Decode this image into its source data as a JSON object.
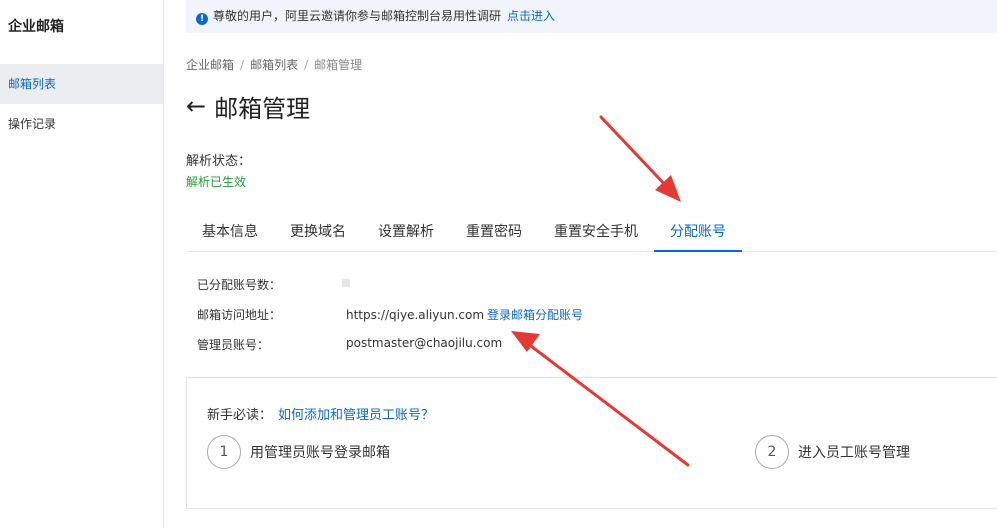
{
  "sidebar": {
    "brand": "企业邮箱",
    "items": [
      {
        "label": "邮箱列表",
        "active": true
      },
      {
        "label": "操作记录",
        "active": false
      }
    ]
  },
  "notice": {
    "icon": "info-icon",
    "text": "尊敬的用户，阿里云邀请你参与邮箱控制台易用性调研",
    "link": "点击进入"
  },
  "breadcrumb": [
    "企业邮箱",
    "邮箱列表",
    "邮箱管理"
  ],
  "page_title": "邮箱管理",
  "status": {
    "label": "解析状态：",
    "value": "解析已生效"
  },
  "tabs": [
    {
      "label": "基本信息"
    },
    {
      "label": "更换域名"
    },
    {
      "label": "设置解析"
    },
    {
      "label": "重置密码"
    },
    {
      "label": "重置安全手机"
    },
    {
      "label": "分配账号",
      "active": true
    }
  ],
  "details": {
    "assigned_label": "已分配账号数：",
    "access_label": "邮箱访问地址：",
    "access_url": "https://qiye.aliyun.com",
    "access_link": "登录邮箱分配账号",
    "admin_label": "管理员账号：",
    "admin_value": "postmaster@chaojilu.com"
  },
  "guide": {
    "prefix": "新手必读：",
    "link": "如何添加和管理员工账号？",
    "steps": [
      {
        "num": "1",
        "label": "用管理员账号登录邮箱"
      },
      {
        "num": "2",
        "label": "进入员工账号管理"
      }
    ]
  },
  "colors": {
    "accent": "#0a69d1",
    "success": "#1e9e35",
    "annotation": "#e53935"
  }
}
